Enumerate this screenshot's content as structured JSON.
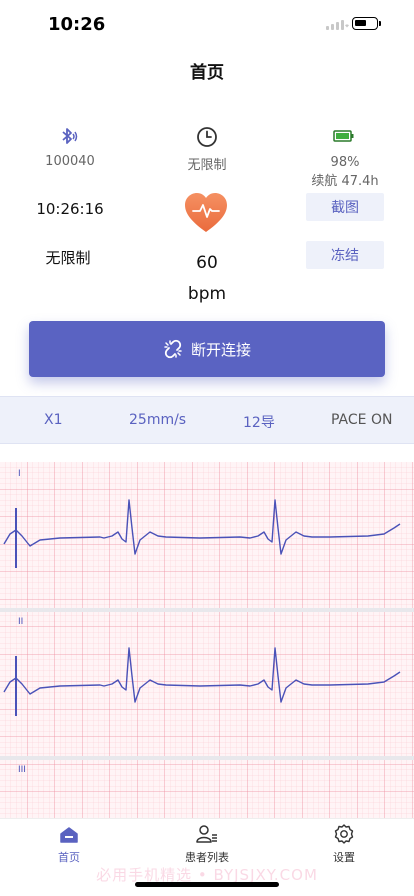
{
  "status_bar": {
    "time": "10:26"
  },
  "header": {
    "title": "首页"
  },
  "device": {
    "bluetooth_id": "100040",
    "duration": "无限制",
    "battery_percent": "98%",
    "battery_runtime": "续航 47.4h"
  },
  "readouts": {
    "clock": "10:26:16",
    "limit": "无限制",
    "heart_rate": "60",
    "heart_rate_unit": "bpm"
  },
  "actions": {
    "screenshot": "截图",
    "freeze": "冻结",
    "disconnect": "断开连接"
  },
  "settings": {
    "gain": "X1",
    "speed": "25mm/s",
    "leads": "12导",
    "pace": "PACE ON"
  },
  "ecg_leads": [
    "I",
    "II",
    "III"
  ],
  "tabs": [
    {
      "label": "首页",
      "icon": "home-icon",
      "active": true
    },
    {
      "label": "患者列表",
      "icon": "patient-list-icon",
      "active": false
    },
    {
      "label": "设置",
      "icon": "settings-gear-icon",
      "active": false
    }
  ],
  "watermark": "必用手机精选 • BYJSJXY.COM",
  "colors": {
    "accent": "#5a63c2",
    "grid": "#f0a0b0",
    "trace": "#4a52b8",
    "heart": "#f07a50"
  }
}
